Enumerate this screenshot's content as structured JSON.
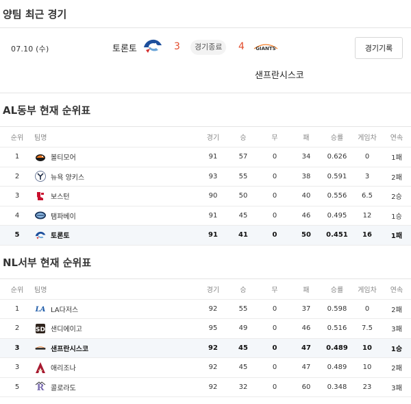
{
  "recent": {
    "title": "양팀 최근 경기",
    "date": "07.10 (수)",
    "team_a": {
      "name": "토론토",
      "score": "3",
      "logo": "blue-jays-logo"
    },
    "status": "경기종료",
    "team_b": {
      "name": "샌프란시스코",
      "score": "4",
      "logo": "giants-logo",
      "logo_text": "GIANTS"
    },
    "record_button": "경기기록",
    "score_color": "#e24b2b"
  },
  "al_east": {
    "title": "AL동부 현재 순위표",
    "headers": [
      "순위",
      "팀명",
      "경기",
      "승",
      "무",
      "패",
      "승률",
      "게임차",
      "연속"
    ],
    "highlight_color": "#f4f7fa",
    "rows": [
      {
        "rank": "1",
        "team": "볼티모어",
        "logo": "orioles-logo",
        "g": "91",
        "w": "57",
        "d": "0",
        "l": "34",
        "pct": "0.626",
        "gb": "0",
        "streak": "1패",
        "highlight": false
      },
      {
        "rank": "2",
        "team": "뉴욕 양키스",
        "logo": "yankees-logo",
        "g": "93",
        "w": "55",
        "d": "0",
        "l": "38",
        "pct": "0.591",
        "gb": "3",
        "streak": "2패",
        "highlight": false
      },
      {
        "rank": "3",
        "team": "보스턴",
        "logo": "red-sox-logo",
        "g": "90",
        "w": "50",
        "d": "0",
        "l": "40",
        "pct": "0.556",
        "gb": "6.5",
        "streak": "2승",
        "highlight": false
      },
      {
        "rank": "4",
        "team": "탬파베이",
        "logo": "rays-logo",
        "g": "91",
        "w": "45",
        "d": "0",
        "l": "46",
        "pct": "0.495",
        "gb": "12",
        "streak": "1승",
        "highlight": false
      },
      {
        "rank": "5",
        "team": "토론토",
        "logo": "blue-jays-logo",
        "g": "91",
        "w": "41",
        "d": "0",
        "l": "50",
        "pct": "0.451",
        "gb": "16",
        "streak": "1패",
        "highlight": true
      }
    ]
  },
  "nl_west": {
    "title": "NL서부 현재 순위표",
    "headers": [
      "순위",
      "팀명",
      "경기",
      "승",
      "무",
      "패",
      "승률",
      "게임차",
      "연속"
    ],
    "rows": [
      {
        "rank": "1",
        "team": "LA다저스",
        "logo": "dodgers-logo",
        "g": "92",
        "w": "55",
        "d": "0",
        "l": "37",
        "pct": "0.598",
        "gb": "0",
        "streak": "2패",
        "highlight": false
      },
      {
        "rank": "2",
        "team": "샌디에이고",
        "logo": "padres-logo",
        "g": "95",
        "w": "49",
        "d": "0",
        "l": "46",
        "pct": "0.516",
        "gb": "7.5",
        "streak": "3패",
        "highlight": false
      },
      {
        "rank": "3",
        "team": "샌프란시스코",
        "logo": "giants-logo",
        "logo_text": "GIANTS",
        "g": "92",
        "w": "45",
        "d": "0",
        "l": "47",
        "pct": "0.489",
        "gb": "10",
        "streak": "1승",
        "highlight": true
      },
      {
        "rank": "3",
        "team": "애리조나",
        "logo": "diamondbacks-logo",
        "g": "92",
        "w": "45",
        "d": "0",
        "l": "47",
        "pct": "0.489",
        "gb": "10",
        "streak": "2패",
        "highlight": false
      },
      {
        "rank": "5",
        "team": "콜로라도",
        "logo": "rockies-logo",
        "g": "92",
        "w": "32",
        "d": "0",
        "l": "60",
        "pct": "0.348",
        "gb": "23",
        "streak": "3패",
        "highlight": false
      }
    ]
  }
}
